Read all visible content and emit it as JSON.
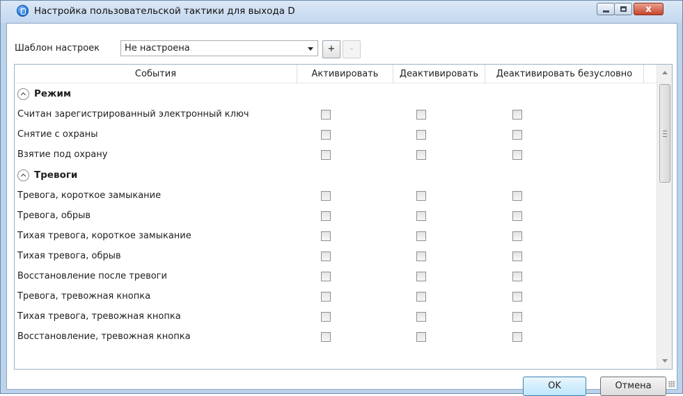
{
  "window": {
    "title": "Настройка пользовательской тактики для выхода D",
    "close_glyph": "x"
  },
  "template": {
    "label": "Шаблон настроек",
    "value": "Не настроена",
    "add_label": "+",
    "remove_label": "-"
  },
  "grid": {
    "columns": [
      "События",
      "Активировать",
      "Деактивировать",
      "Деактивировать безусловно"
    ],
    "groups": [
      {
        "title": "Режим",
        "events": [
          "Считан зарегистрированный электронный ключ",
          "Снятие с охраны",
          "Взятие под охрану"
        ]
      },
      {
        "title": "Тревоги",
        "events": [
          "Тревога, короткое замыкание",
          "Тревога, обрыв",
          "Тихая тревога, короткое замыкание",
          "Тихая тревога, обрыв",
          "Восстановление после тревоги",
          "Тревога, тревожная кнопка",
          "Тихая тревога, тревожная кнопка",
          "Восстановление, тревожная кнопка"
        ]
      }
    ]
  },
  "buttons": {
    "ok": "OK",
    "cancel": "Отмена"
  },
  "icons": {
    "app": "info-circle-icon",
    "collapse": "chevron-up-icon"
  }
}
